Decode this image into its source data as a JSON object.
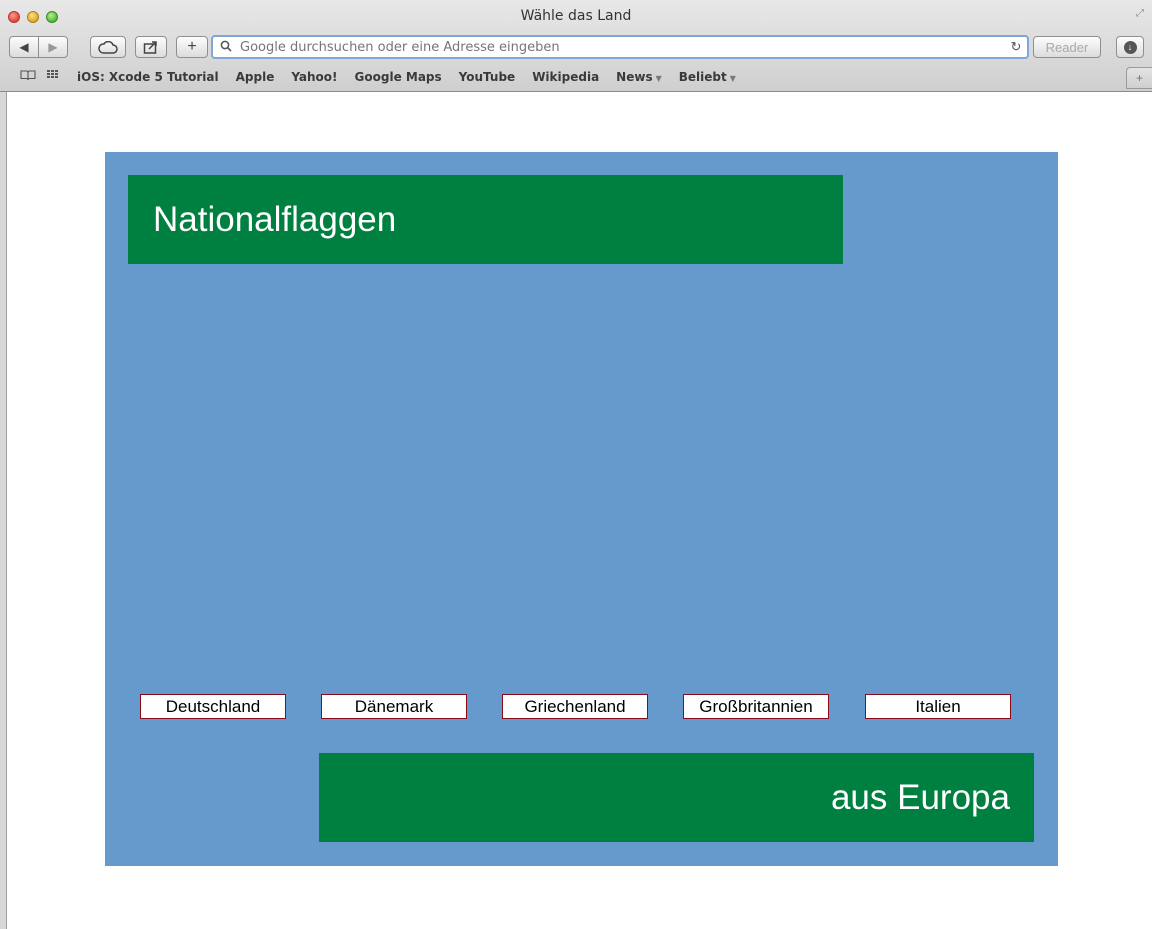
{
  "browser": {
    "window_title": "Wähle das Land",
    "url_placeholder": "Google durchsuchen oder eine Adresse eingeben",
    "reader_label": "Reader",
    "bookmarks": [
      "iOS: Xcode 5 Tutorial",
      "Apple",
      "Yahoo!",
      "Google Maps",
      "YouTube",
      "Wikipedia",
      "News",
      "Beliebt"
    ]
  },
  "page": {
    "title": "Nationalflaggen",
    "subtitle": "aus Europa",
    "countries": [
      "Deutschland",
      "Dänemark",
      "Griechenland",
      "Großbritannien",
      "Italien"
    ]
  },
  "colors": {
    "stage_bg": "#6699cc",
    "banner_green": "#008040",
    "button_border": "#8b0a1a"
  }
}
